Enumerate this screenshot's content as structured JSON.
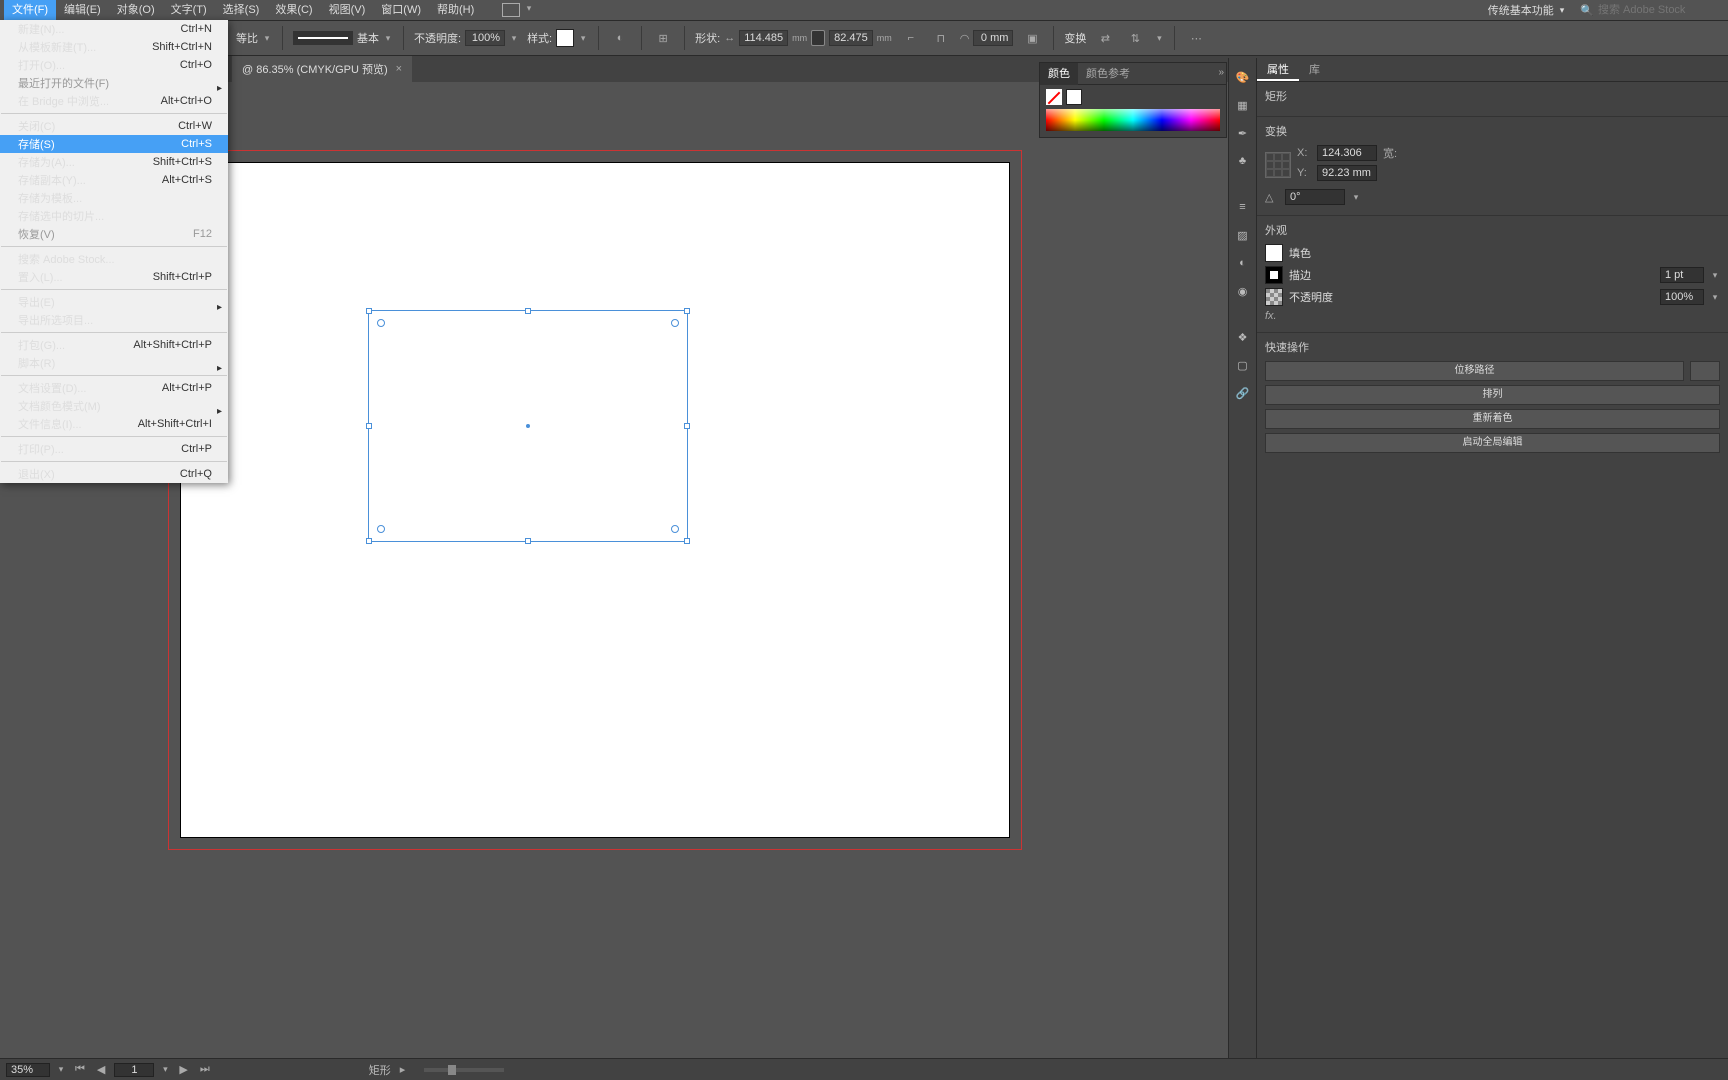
{
  "menubar": {
    "items": [
      "文件(F)",
      "编辑(E)",
      "对象(O)",
      "文字(T)",
      "选择(S)",
      "效果(C)",
      "视图(V)",
      "窗口(W)",
      "帮助(H)"
    ],
    "workspace": "传统基本功能",
    "search_placeholder": "搜索 Adobe Stock"
  },
  "file_menu": [
    {
      "label": "新建(N)...",
      "shortcut": "Ctrl+N"
    },
    {
      "label": "从模板新建(T)...",
      "shortcut": "Shift+Ctrl+N"
    },
    {
      "label": "打开(O)...",
      "shortcut": "Ctrl+O"
    },
    {
      "label": "最近打开的文件(F)",
      "shortcut": "",
      "sub": true,
      "disabled": true
    },
    {
      "label": "在 Bridge 中浏览...",
      "shortcut": "Alt+Ctrl+O"
    },
    {
      "divider": true
    },
    {
      "label": "关闭(C)",
      "shortcut": "Ctrl+W"
    },
    {
      "label": "存储(S)",
      "shortcut": "Ctrl+S",
      "hover": true
    },
    {
      "label": "存储为(A)...",
      "shortcut": "Shift+Ctrl+S"
    },
    {
      "label": "存储副本(Y)...",
      "shortcut": "Alt+Ctrl+S"
    },
    {
      "label": "存储为模板..."
    },
    {
      "label": "存储选中的切片..."
    },
    {
      "label": "恢复(V)",
      "shortcut": "F12",
      "disabled": true
    },
    {
      "divider": true
    },
    {
      "label": "搜索 Adobe Stock..."
    },
    {
      "label": "置入(L)...",
      "shortcut": "Shift+Ctrl+P"
    },
    {
      "divider": true
    },
    {
      "label": "导出(E)",
      "sub": true
    },
    {
      "label": "导出所选项目..."
    },
    {
      "divider": true
    },
    {
      "label": "打包(G)...",
      "shortcut": "Alt+Shift+Ctrl+P"
    },
    {
      "label": "脚本(R)",
      "sub": true
    },
    {
      "divider": true
    },
    {
      "label": "文档设置(D)...",
      "shortcut": "Alt+Ctrl+P"
    },
    {
      "label": "文档颜色模式(M)",
      "sub": true
    },
    {
      "label": "文件信息(I)...",
      "shortcut": "Alt+Shift+Ctrl+I"
    },
    {
      "divider": true
    },
    {
      "label": "打印(P)...",
      "shortcut": "Ctrl+P"
    },
    {
      "divider": true
    },
    {
      "label": "退出(X)",
      "shortcut": "Ctrl+Q"
    }
  ],
  "optbar": {
    "uniform": "等比",
    "stroke_profile": "基本",
    "opacity_label": "不透明度:",
    "opacity": "100%",
    "style_label": "样式:",
    "shape_label": "形状:",
    "width": "114.485",
    "height": "82.475",
    "unit": "mm",
    "corner": "0 mm",
    "transform": "变换"
  },
  "document_tab": {
    "title": "@ 86.35% (CMYK/GPU 预览)"
  },
  "color_panel": {
    "tab_color": "颜色",
    "tab_guide": "颜色参考"
  },
  "props": {
    "tab_props": "属性",
    "tab_lib": "库",
    "shape_title": "矩形",
    "transform_title": "变换",
    "x": "124.306",
    "y": "92.23 mm",
    "angle": "0°",
    "w_lbl": "宽:",
    "appearance_title": "外观",
    "fill": "填色",
    "stroke": "描边",
    "stroke_w": "1 pt",
    "opacity": "不透明度",
    "opacity_v": "100%",
    "fx": "fx.",
    "quick_title": "快速操作",
    "btn_offset": "位移路径",
    "btn_arrange": "排列",
    "btn_recolor": "重新着色",
    "btn_global": "启动全局编辑"
  },
  "status": {
    "zoom": "35%",
    "artboard": "1",
    "selection": "矩形"
  }
}
